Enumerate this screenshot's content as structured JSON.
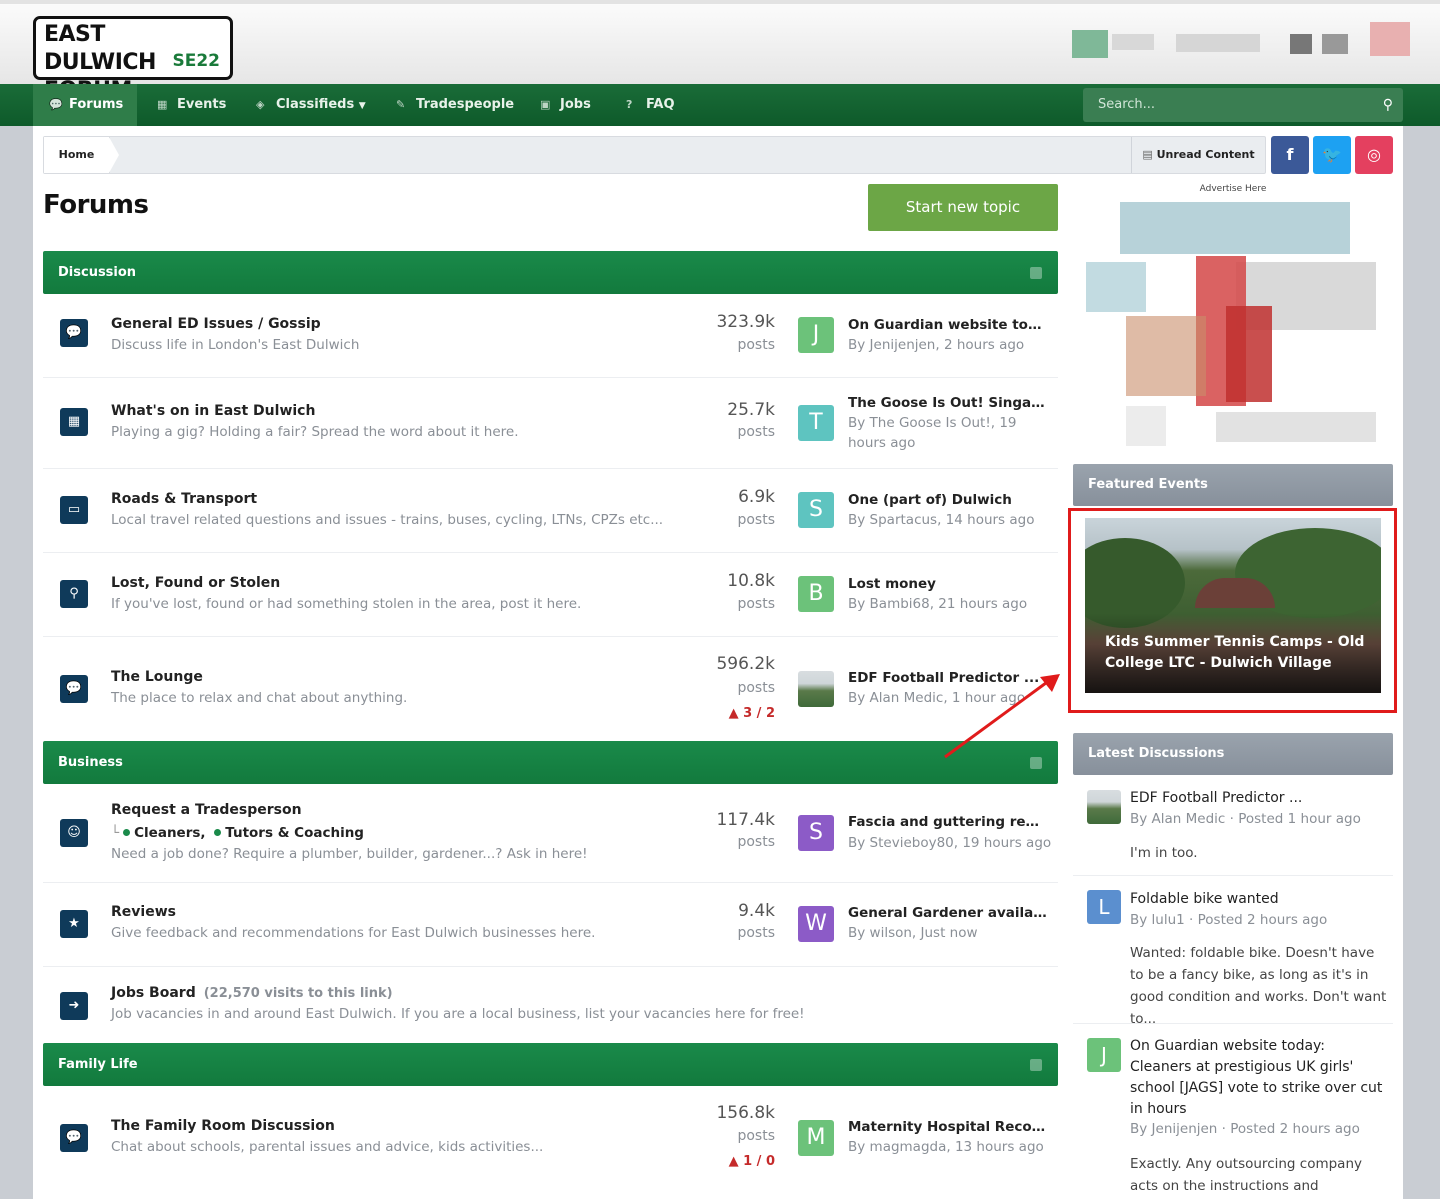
{
  "logo": {
    "line1": "EAST DULWICH",
    "line2": "FORUM",
    "badge": "SE22"
  },
  "nav": [
    {
      "label": "Forums",
      "icon": "comments-icon"
    },
    {
      "label": "Events",
      "icon": "calendar-icon"
    },
    {
      "label": "Classifieds",
      "icon": "tags-icon",
      "dropdown": true
    },
    {
      "label": "Tradespeople",
      "icon": "wrench-icon"
    },
    {
      "label": "Jobs",
      "icon": "briefcase-icon"
    },
    {
      "label": "FAQ",
      "icon": "question-icon"
    }
  ],
  "search": {
    "placeholder": "Search..."
  },
  "breadcrumb": {
    "home": "Home",
    "unread": "Unread Content"
  },
  "social": [
    "f",
    "t",
    "ig"
  ],
  "page_title": "Forums",
  "start_topic": "Start new topic",
  "categories": [
    {
      "name": "Discussion"
    },
    {
      "name": "Business"
    },
    {
      "name": "Family Life"
    }
  ],
  "forums": [
    {
      "title": "General ED Issues / Gossip",
      "desc": "Discuss life in London's East Dulwich",
      "count": "323.9k",
      "posts": "posts",
      "last_title": "On Guardian website toda...",
      "last_by": "By Jenijenjen, 2 hours ago",
      "avatar": "J"
    },
    {
      "title": "What's on in East Dulwich",
      "desc": "Playing a gig? Holding a fair? Spread the word about it here.",
      "count": "25.7k",
      "posts": "posts",
      "last_title": "The Goose Is Out! Singaro...",
      "last_by": "By The Goose Is Out!, 19 hours ago",
      "avatar": "T"
    },
    {
      "title": "Roads & Transport",
      "desc": "Local travel related questions and issues - trains, buses, cycling, LTNs, CPZs etc...",
      "count": "6.9k",
      "posts": "posts",
      "last_title": "One (part of) Dulwich",
      "last_by": "By Spartacus, 14 hours ago",
      "avatar": "S"
    },
    {
      "title": "Lost, Found or Stolen",
      "desc": "If you've lost, found or had something stolen in the area, post it here.",
      "count": "10.8k",
      "posts": "posts",
      "last_title": "Lost money",
      "last_by": "By Bambi68, 21 hours ago",
      "avatar": "B"
    },
    {
      "title": "The Lounge",
      "desc": "The place to relax and chat about anything.",
      "count": "596.2k",
      "posts": "posts",
      "alert": "3 / 2",
      "last_title": "EDF Football Predictor ...",
      "last_by": "By Alan Medic, 1 hour ago"
    },
    {
      "title": "Request a Tradesperson",
      "sub1": "Cleaners,",
      "sub2": "Tutors & Coaching",
      "desc": "Need a job done? Require a plumber, builder, gardener...? Ask in here!",
      "count": "117.4k",
      "posts": "posts",
      "last_title": "Fascia and guttering repai...",
      "last_by": "By Stevieboy80, 19 hours ago",
      "avatar": "S"
    },
    {
      "title": "Reviews",
      "desc": "Give feedback and recommendations for East Dulwich businesses here.",
      "count": "9.4k",
      "posts": "posts",
      "last_title": "General Gardener available",
      "last_by": "By wilson, Just now",
      "avatar": "W"
    },
    {
      "title": "Jobs Board",
      "visits": "(22,570 visits to this link)",
      "desc": "Job vacancies in and around East Dulwich. If you are a local business, list your vacancies here for free!"
    },
    {
      "title": "The Family Room Discussion",
      "desc": "Chat about schools, parental issues and advice, kids activities...",
      "count": "156.8k",
      "posts": "posts",
      "alert": "1 / 0",
      "last_title": "Maternity Hospital Recom...",
      "last_by": "By magmagda, 13 hours ago",
      "avatar": "M"
    }
  ],
  "sidebar": {
    "ad_label": "Advertise Here",
    "featured_title": "Featured Events",
    "event_title": "Kids Summer Tennis Camps - Old College LTC - Dulwich Village",
    "latest_title": "Latest Discussions",
    "discussions": [
      {
        "title": "EDF Football Predictor ...",
        "meta": "By Alan Medic · Posted 1 hour ago",
        "body": "I'm in too."
      },
      {
        "title": "Foldable bike wanted",
        "meta": "By lulu1 · Posted 2 hours ago",
        "body": "Wanted: foldable bike. Doesn't have to be a fancy bike, as long as it's in good condition and works. Don't want to...",
        "avatar": "L"
      },
      {
        "title": "On Guardian website today: Cleaners at prestigious UK girls' school [JAGS] vote to strike over cut in hours",
        "meta": "By Jenijenjen · Posted 2 hours ago",
        "body": "Exactly. Any outsourcing company acts on the instructions and requirements",
        "avatar": "J"
      }
    ]
  },
  "colors": {
    "nav_green": "#0e5a2a",
    "cat_green": "#1a8a4a",
    "start_btn": "#6ca646",
    "facebook": "#3b5998",
    "twitter": "#1da1f2",
    "instagram": "#e4405f",
    "highlight_red": "#e01b1b"
  }
}
